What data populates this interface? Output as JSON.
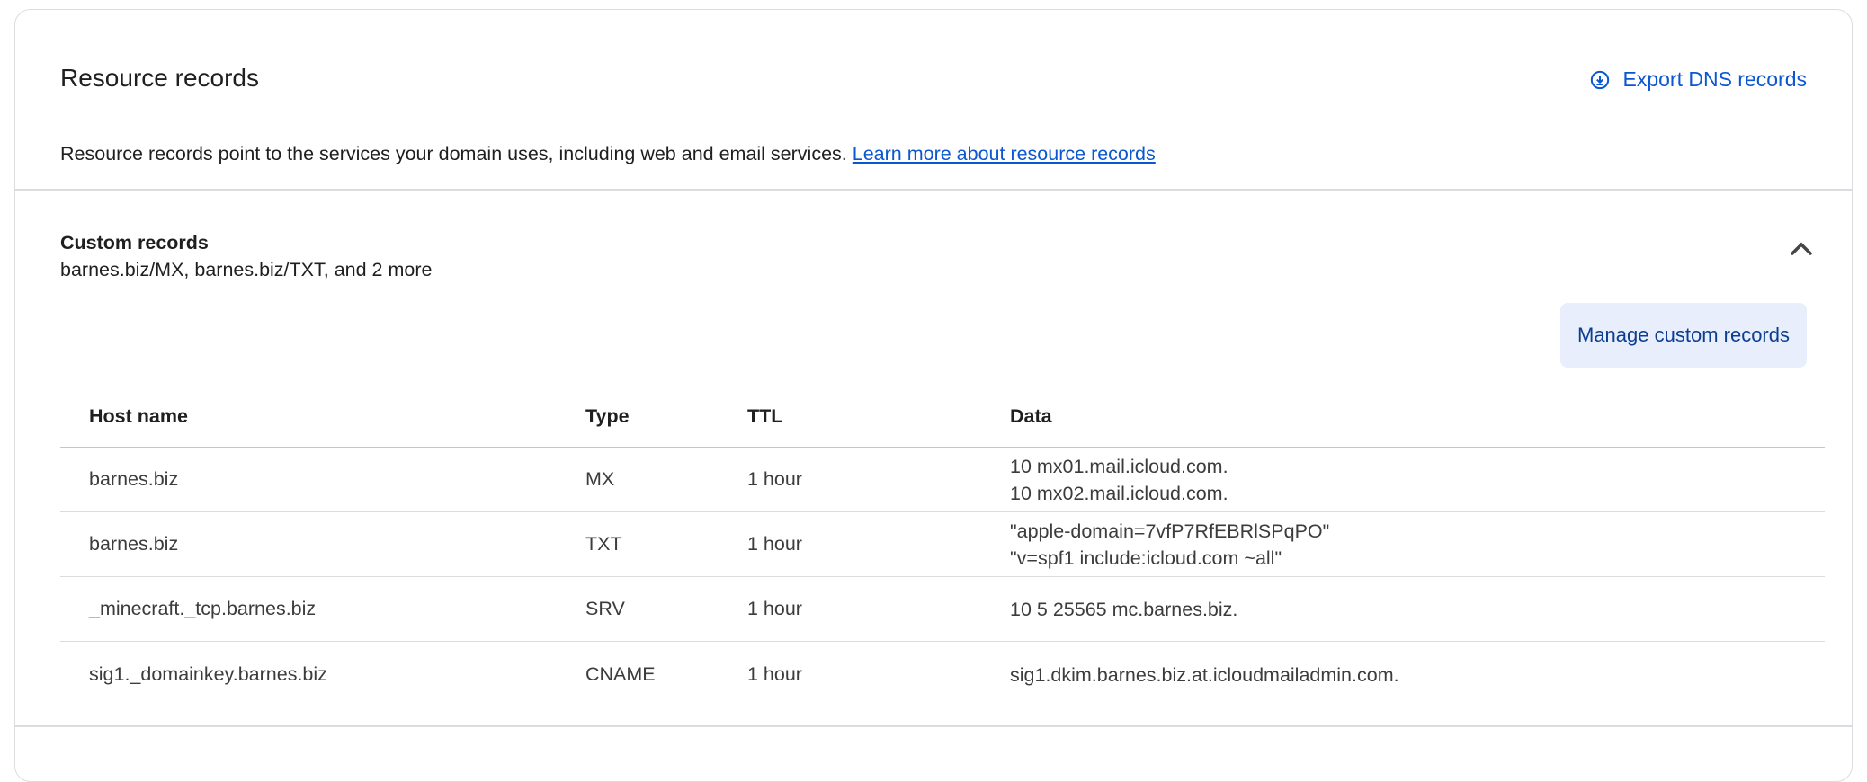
{
  "header": {
    "title": "Resource records",
    "export_label": "Export DNS records",
    "export_icon": "download-circle-icon"
  },
  "description": {
    "text": "Resource records point to the services your domain uses, including web and email services.",
    "link": "Learn more about resource records"
  },
  "custom_records": {
    "title": "Custom records",
    "summary": "barnes.biz/MX, barnes.biz/TXT, and 2 more",
    "collapse_icon": "chevron-up-icon",
    "manage_label": "Manage custom records",
    "columns": [
      "Host name",
      "Type",
      "TTL",
      "Data"
    ],
    "rows": [
      {
        "host": "barnes.biz",
        "type": "MX",
        "ttl": "1 hour",
        "data": [
          "10 mx01.mail.icloud.com.",
          "10 mx02.mail.icloud.com."
        ]
      },
      {
        "host": "barnes.biz",
        "type": "TXT",
        "ttl": "1 hour",
        "data": [
          "\"apple-domain=7vfP7RfEBRlSPqPO\"",
          "\"v=spf1 include:icloud.com ~all\""
        ]
      },
      {
        "host": "_minecraft._tcp.barnes.biz",
        "type": "SRV",
        "ttl": "1 hour",
        "data": [
          "10 5 25565 mc.barnes.biz."
        ]
      },
      {
        "host": "sig1._domainkey.barnes.biz",
        "type": "CNAME",
        "ttl": "1 hour",
        "data": [
          "sig1.dkim.barnes.biz.at.icloudmailadmin.com."
        ]
      }
    ]
  },
  "colors": {
    "accent": "#0b57d0",
    "button_bg": "#e8eefc",
    "border": "#dadce0"
  }
}
